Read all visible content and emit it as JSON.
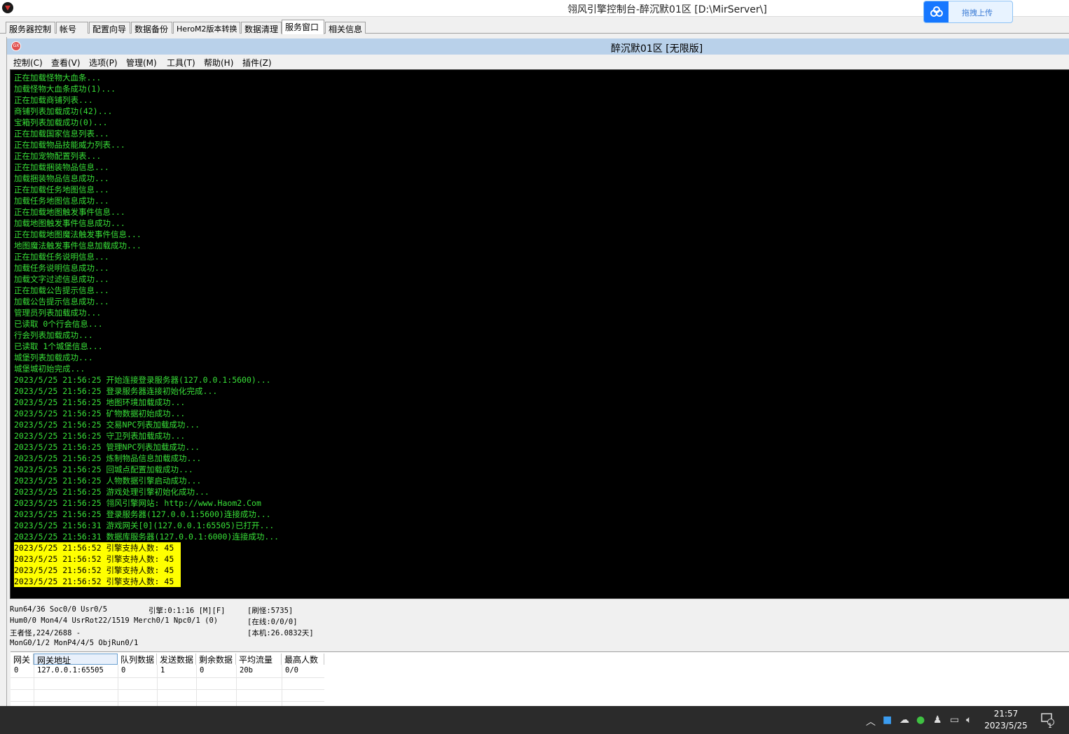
{
  "window": {
    "title": "翎风引擎控制台-醉沉默01区 [D:\\MirServer\\]"
  },
  "upload": {
    "label": "拖拽上传"
  },
  "tabs": [
    "服务器控制",
    "帐号",
    "配置向导",
    "数据备份",
    "HeroM2版本转换",
    "数据清理",
    "服务窗口",
    "相关信息"
  ],
  "inner": {
    "title": "醉沉默01区 [无限版]"
  },
  "menu": [
    "控制(C)",
    "查看(V)",
    "选项(P)",
    "管理(M)",
    "工具(T)",
    "帮助(H)",
    "插件(Z)"
  ],
  "log": [
    "正在加载怪物大血条...",
    "加载怪物大血条成功(1)...",
    "正在加载商铺列表...",
    "商铺列表加载成功(42)...",
    "宝箱列表加载成功(0)...",
    "正在加载国家信息列表...",
    "正在加载物品技能威力列表...",
    "正在加宠物配置列表...",
    "正在加载捆装物品信息...",
    "加载捆装物品信息成功...",
    "正在加载任务地图信息...",
    "加载任务地图信息成功...",
    "正在加载地图触发事件信息...",
    "加载地图触发事件信息成功...",
    "正在加载地图魔法触发事件信息...",
    "地图魔法触发事件信息加载成功...",
    "正在加载任务说明信息...",
    "加载任务说明信息成功...",
    "加载文字过滤信息成功...",
    "正在加载公告提示信息...",
    "加载公告提示信息成功...",
    "管理员列表加载成功...",
    "已读取 0个行会信息...",
    "行会列表加载成功...",
    "已读取 1个城堡信息...",
    "城堡列表加载成功...",
    "城堡城初始完成...",
    "2023/5/25 21:56:25 开始连接登录服务器(127.0.0.1:5600)...",
    "2023/5/25 21:56:25 登录服务器连接初始化完成...",
    "2023/5/25 21:56:25 地图环境加载成功...",
    "2023/5/25 21:56:25 矿物数据初始成功...",
    "2023/5/25 21:56:25 交易NPC列表加载成功...",
    "2023/5/25 21:56:25 守卫列表加载成功...",
    "2023/5/25 21:56:25 管理NPC列表加载成功...",
    "2023/5/25 21:56:25 炼制物品信息加载成功...",
    "2023/5/25 21:56:25 回城点配置加载成功...",
    "2023/5/25 21:56:25 人物数据引擎启动成功...",
    "2023/5/25 21:56:25 游戏处理引擎初始化成功...",
    "2023/5/25 21:56:25 翎风引擎网站: http://www.Haom2.Com",
    "2023/5/25 21:56:25 登录服务器(127.0.0.1:5600)连接成功...",
    "2023/5/25 21:56:31 游戏网关[0](127.0.0.1:65505)已打开...",
    "2023/5/25 21:56:31 数据库服务器(127.0.0.1:6000)连接成功..."
  ],
  "log_highlight": [
    "2023/5/25 21:56:52 引擎支持人数: 45",
    "2023/5/25 21:56:52 引擎支持人数: 45",
    "2023/5/25 21:56:52 引擎支持人数: 45",
    "2023/5/25 21:56:52 引擎支持人数: 45"
  ],
  "status": {
    "line1": "Run64/36 Soc0/0 Usr0/5",
    "line2": "Hum0/0 Mon4/4 UsrRot22/1519 Merch0/1 Npc0/1 (0)",
    "line3": "王者怪,224/2688 -",
    "line4": "MonG0/1/2 MonP4/4/5 ObjRun0/1",
    "engine": "引擎:0:1:16 [M][F]",
    "refresh": "[刷怪:5735]",
    "online": "[在线:0/0/0]",
    "local": "[本机:26.0832天]"
  },
  "gateway": {
    "headers": [
      "网关",
      "网关地址",
      "队列数据",
      "发送数据",
      "剩余数据",
      "平均流量",
      "最高人数"
    ],
    "rows": [
      [
        "0",
        "127.0.0.1:65505",
        "0",
        "1",
        "0",
        "20b",
        "0/0"
      ]
    ]
  },
  "taskbar": {
    "time": "21:57",
    "date": "2023/5/25",
    "notifications": "1"
  }
}
